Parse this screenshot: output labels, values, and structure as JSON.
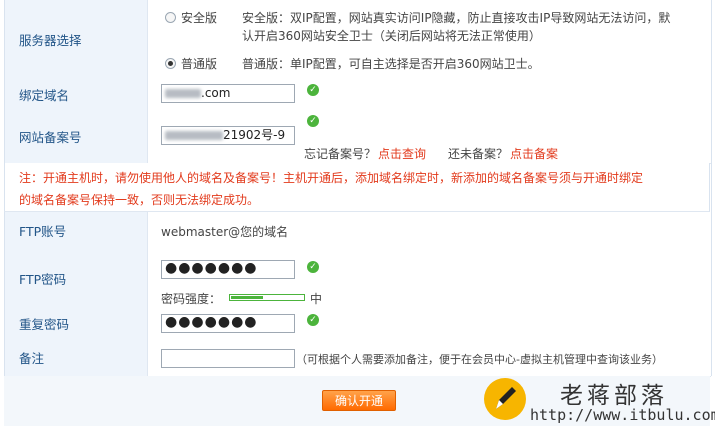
{
  "server": {
    "label": "服务器选择",
    "safe_option": "安全版",
    "safe_desc_line1": "安全版：双IP配置，网站真实访问IP隐藏，防止直接攻击IP导致网站无法访问，默",
    "safe_desc_line2": "认开启360网站安全卫士（关闭后网站将无法正常使用）",
    "normal_option": "普通版",
    "normal_desc": "普通版：单IP配置，可自主选择是否开启360网站卫士。",
    "selected": "普通版"
  },
  "domain": {
    "label": "绑定域名",
    "value_suffix": ".com"
  },
  "icp": {
    "label": "网站备案号",
    "value_suffix": "21902号-9",
    "forgot_text": "忘记备案号？",
    "forgot_link": "点击查询",
    "none_text": "还未备案？",
    "none_link": "点击备案"
  },
  "notice": {
    "line1": "注：开通主机时，请勿使用他人的域名及备案号！主机开通后，添加域名绑定时，新添加的域名备案号须与开通时绑定",
    "line2": "的域名备案号保持一致，否则无法绑定成功。"
  },
  "ftp_account": {
    "label": "FTP账号",
    "value": "webmaster@您的域名"
  },
  "ftp_password": {
    "label": "FTP密码",
    "value": "●●●●●●●",
    "strength_label": "密码强度：",
    "strength_value": "中",
    "strength_fraction": 0.45
  },
  "repeat_password": {
    "label": "重复密码",
    "value": "●●●●●●●"
  },
  "remark": {
    "label": "备注",
    "hint": "（可根据个人需要添加备注，便于在会员中心-虚拟主机管理中查询该业务）",
    "value": ""
  },
  "submit": {
    "label": "确认开通"
  },
  "watermark": {
    "title": "老蒋部落",
    "url": "http://www.itbulu.com"
  },
  "colors": {
    "label_bg": "#eef4fb",
    "label_text": "#225588",
    "notice": "#e23a1c",
    "ok": "#4cb43c",
    "button": "#ff6a00"
  }
}
